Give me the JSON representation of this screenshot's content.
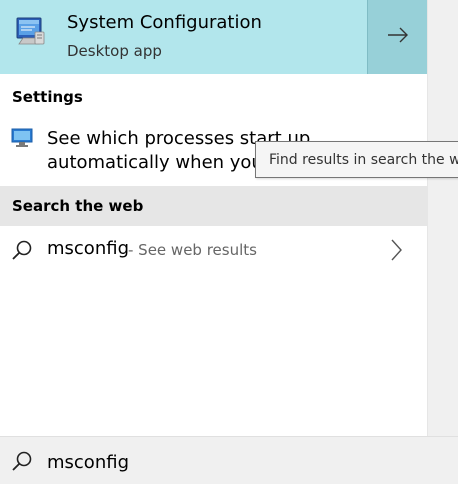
{
  "best_match": {
    "title": "System Configuration",
    "subtitle": "Desktop app",
    "icon": "system-configuration-icon",
    "open_icon": "arrow-right-icon"
  },
  "settings_section": {
    "header": "Settings",
    "item": {
      "icon": "monitor-icon",
      "line1": "See which processes start up",
      "line2": "automatically when you s"
    }
  },
  "tooltip": {
    "text": "Find results in search the web"
  },
  "web_section": {
    "header": "Search the web",
    "item": {
      "icon": "search-icon",
      "query": "msconfig",
      "suffix": "- See web results",
      "chevron": "chevron-right-icon"
    }
  },
  "search_bar": {
    "icon": "search-icon",
    "value": "msconfig"
  },
  "colors": {
    "best_match_bg": "#b2e6ec",
    "open_button_bg": "#97d0d8",
    "web_header_bg": "#e6e6e6",
    "search_bar_bg": "#f0f0f0"
  }
}
